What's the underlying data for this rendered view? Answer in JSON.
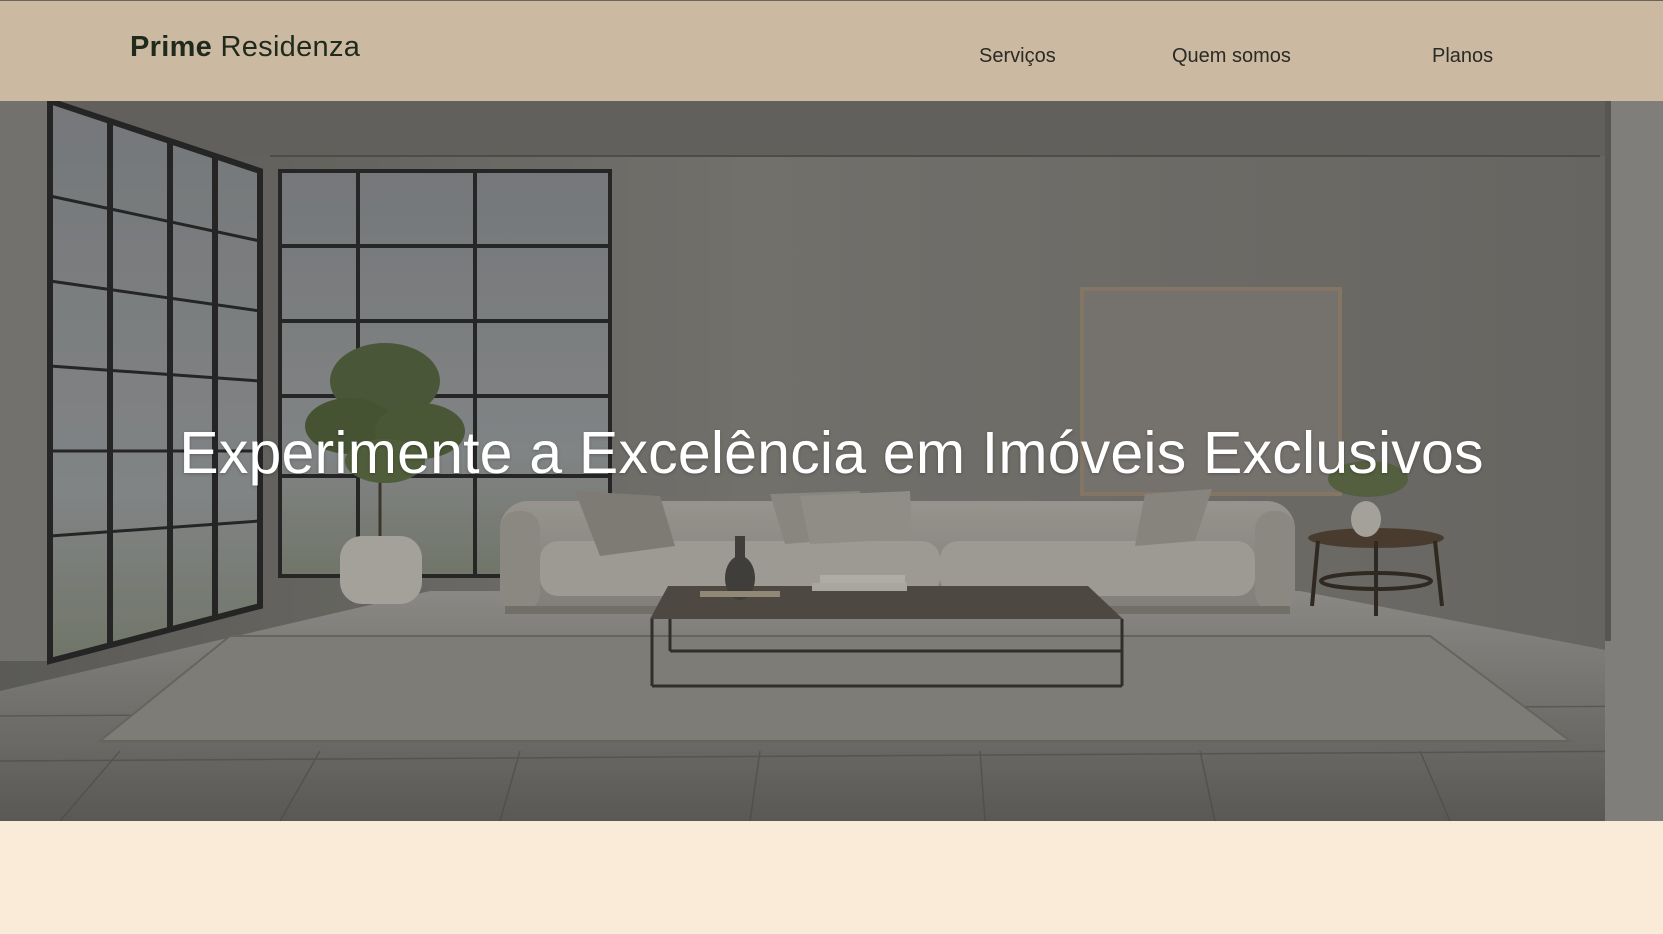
{
  "brand": {
    "name_bold": "Prime",
    "name_light": " Residenza"
  },
  "nav": {
    "items": [
      {
        "label": "Serviços"
      },
      {
        "label": "Quem somos"
      },
      {
        "label": "Planos"
      }
    ]
  },
  "hero": {
    "title": "Experimente a Excelência em Imóveis Exclusivos"
  },
  "colors": {
    "header_bg": "#cbb9a1",
    "page_bg": "#f9ebd8",
    "hero_text": "#ffffff",
    "nav_text": "#2a2a26"
  }
}
